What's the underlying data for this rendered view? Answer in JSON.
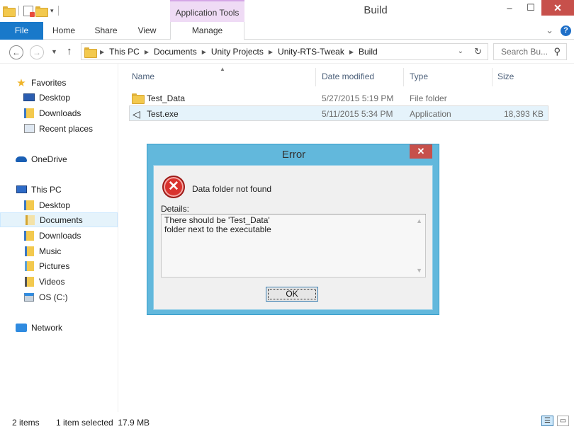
{
  "window": {
    "title": "Build",
    "context_tab": "Application Tools",
    "minimize": "–",
    "maximize": "☐",
    "close": "✕"
  },
  "ribbon": {
    "tabs": [
      "File",
      "Home",
      "Share",
      "View",
      "Manage"
    ],
    "expand": "⌄",
    "help": "?"
  },
  "nav": {
    "back": "←",
    "forward": "→",
    "recent": "▼",
    "up": "↑",
    "breadcrumbs": [
      "This PC",
      "Documents",
      "Unity Projects",
      "Unity-RTS-Tweak",
      "Build"
    ],
    "address_dropdown": "⌄",
    "refresh": "↻",
    "search_placeholder": "Search Bu...",
    "search_icon": "search-icon"
  },
  "navpane": {
    "favorites": "Favorites",
    "fav_items": [
      "Desktop",
      "Downloads",
      "Recent places"
    ],
    "onedrive": "OneDrive",
    "thispc": "This PC",
    "pc_items": [
      "Desktop",
      "Documents",
      "Downloads",
      "Music",
      "Pictures",
      "Videos",
      "OS (C:)"
    ],
    "network": "Network",
    "selected": "Documents"
  },
  "columns": {
    "name": "Name",
    "date": "Date modified",
    "type": "Type",
    "size": "Size"
  },
  "files": [
    {
      "name": "Test_Data",
      "date": "5/27/2015 5:19 PM",
      "type": "File folder",
      "size": ""
    },
    {
      "name": "Test.exe",
      "date": "5/11/2015 5:34 PM",
      "type": "Application",
      "size": "18,393 KB"
    }
  ],
  "dialog": {
    "title": "Error",
    "close": "✕",
    "message": "Data folder not found",
    "details_label": "Details:",
    "details_text": "There should be 'Test_Data'\nfolder next to the executable",
    "ok": "OK",
    "error_glyph": "✕"
  },
  "status": {
    "items": "2 items",
    "selection": "1 item selected  17.9 MB"
  },
  "colors": {
    "accent": "#1979ca",
    "dialog_frame": "#62b8dc",
    "close_red": "#c7504b",
    "context_tab": "#efdbf5"
  }
}
